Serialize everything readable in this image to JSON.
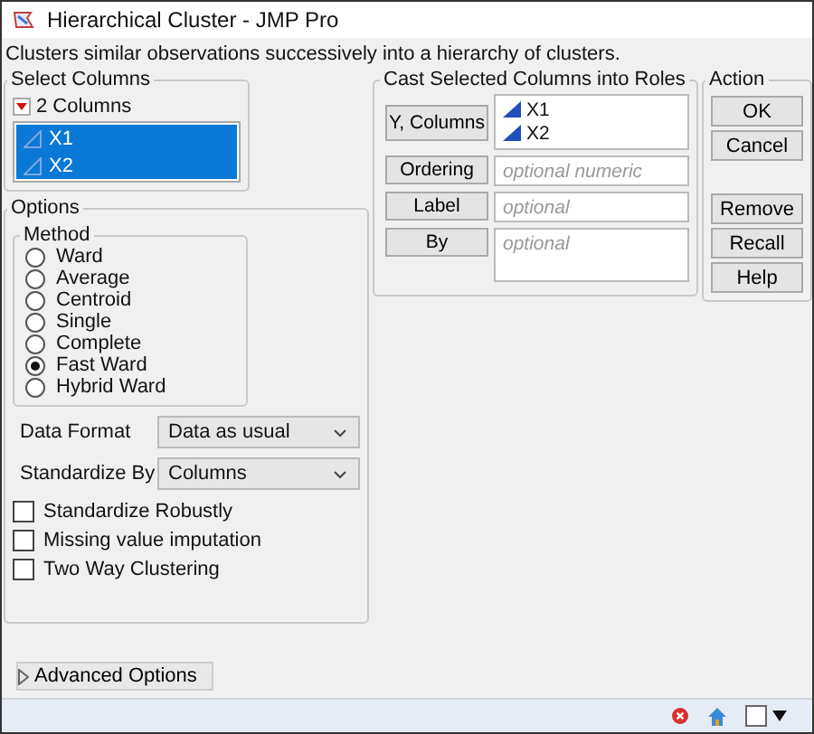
{
  "window": {
    "title": "Hierarchical Cluster - JMP Pro"
  },
  "description": "Clusters similar observations successively into a hierarchy of clusters.",
  "select_columns": {
    "title": "Select Columns",
    "count_label": "2 Columns",
    "columns": [
      {
        "name": "X1",
        "selected": true
      },
      {
        "name": "X2",
        "selected": true
      }
    ]
  },
  "roles": {
    "title": "Cast Selected Columns into Roles",
    "rows": [
      {
        "button": "Y, Columns",
        "items": [
          "X1",
          "X2"
        ]
      },
      {
        "button": "Ordering",
        "placeholder": "optional numeric"
      },
      {
        "button": "Label",
        "placeholder": "optional"
      },
      {
        "button": "By",
        "placeholder": "optional"
      }
    ]
  },
  "action": {
    "title": "Action",
    "groups": [
      [
        "OK",
        "Cancel"
      ],
      [
        "Remove",
        "Recall",
        "Help"
      ]
    ]
  },
  "options": {
    "title": "Options",
    "method": {
      "title": "Method",
      "choices": [
        {
          "label": "Ward",
          "selected": false
        },
        {
          "label": "Average",
          "selected": false
        },
        {
          "label": "Centroid",
          "selected": false
        },
        {
          "label": "Single",
          "selected": false
        },
        {
          "label": "Complete",
          "selected": false
        },
        {
          "label": "Fast Ward",
          "selected": true
        },
        {
          "label": "Hybrid Ward",
          "selected": false
        }
      ]
    },
    "dropdowns": [
      {
        "label": "Data Format",
        "value": "Data as usual"
      },
      {
        "label": "Standardize By",
        "value": "Columns"
      }
    ],
    "checkboxes": [
      {
        "label": "Standardize Robustly",
        "checked": false
      },
      {
        "label": "Missing value imputation",
        "checked": false
      },
      {
        "label": "Two Way Clustering",
        "checked": false
      }
    ]
  },
  "advanced_options": {
    "label": "Advanced Options",
    "expanded": false
  }
}
